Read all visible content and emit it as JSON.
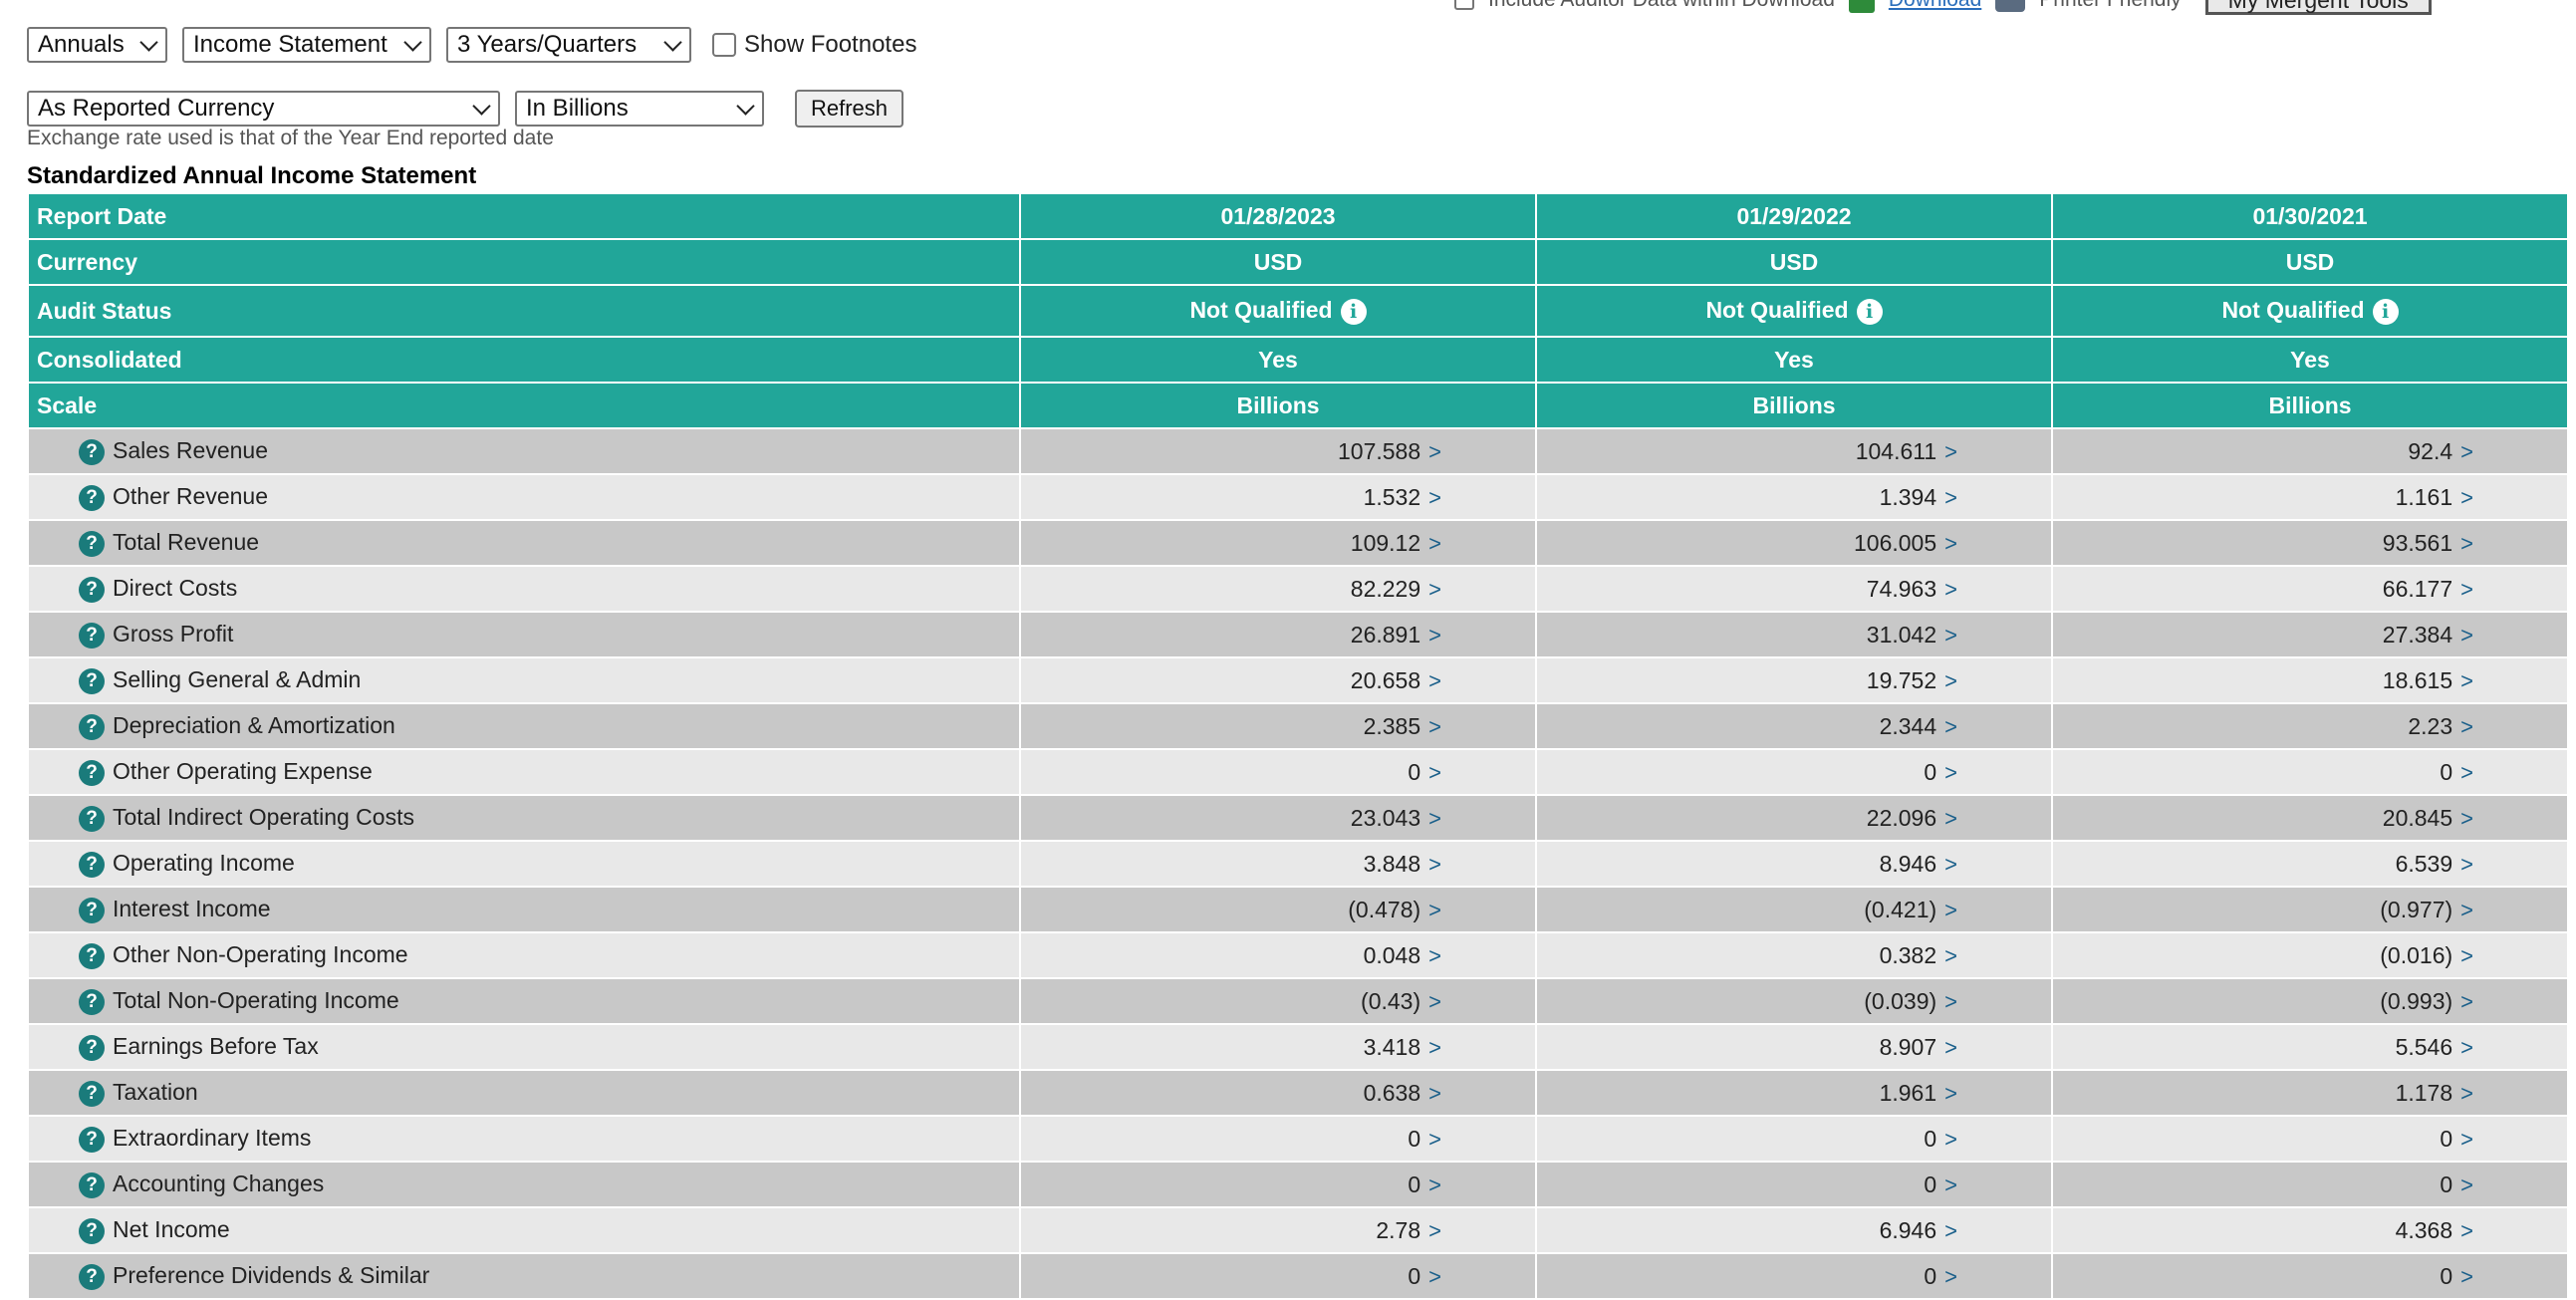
{
  "toolbar": {
    "include_text": "Include Auditor Data within Download",
    "download_label": "Download",
    "printer_label": "Printer Friendly",
    "mytools_label": "My Mergent Tools"
  },
  "controls": {
    "period_select": "Annuals",
    "statement_select": "Income Statement",
    "range_select": "3 Years/Quarters",
    "footnotes_label": "Show Footnotes",
    "currency_select": "As Reported Currency",
    "scale_select": "In Billions",
    "refresh_label": "Refresh",
    "exchange_note": "Exchange rate used is that of the Year End reported date"
  },
  "section_title": "Standardized Annual Income Statement",
  "header_rows": [
    {
      "label": "Report Date",
      "values": [
        "01/28/2023",
        "01/29/2022",
        "01/30/2021"
      ]
    },
    {
      "label": "Currency",
      "values": [
        "USD",
        "USD",
        "USD"
      ]
    },
    {
      "label": "Audit Status",
      "values": [
        "Not Qualified",
        "Not Qualified",
        "Not Qualified"
      ]
    },
    {
      "label": "Consolidated",
      "values": [
        "Yes",
        "Yes",
        "Yes"
      ]
    },
    {
      "label": "Scale",
      "values": [
        "Billions",
        "Billions",
        "Billions"
      ]
    }
  ],
  "rows": [
    {
      "label": "Sales Revenue",
      "values": [
        "107.588",
        "104.611",
        "92.4"
      ]
    },
    {
      "label": "Other Revenue",
      "values": [
        "1.532",
        "1.394",
        "1.161"
      ]
    },
    {
      "label": "Total Revenue",
      "values": [
        "109.12",
        "106.005",
        "93.561"
      ]
    },
    {
      "label": "Direct Costs",
      "values": [
        "82.229",
        "74.963",
        "66.177"
      ]
    },
    {
      "label": "Gross Profit",
      "values": [
        "26.891",
        "31.042",
        "27.384"
      ]
    },
    {
      "label": "Selling General & Admin",
      "values": [
        "20.658",
        "19.752",
        "18.615"
      ]
    },
    {
      "label": "Depreciation & Amortization",
      "values": [
        "2.385",
        "2.344",
        "2.23"
      ]
    },
    {
      "label": "Other Operating Expense",
      "values": [
        "0",
        "0",
        "0"
      ]
    },
    {
      "label": "Total Indirect Operating Costs",
      "values": [
        "23.043",
        "22.096",
        "20.845"
      ]
    },
    {
      "label": "Operating Income",
      "values": [
        "3.848",
        "8.946",
        "6.539"
      ]
    },
    {
      "label": "Interest Income",
      "values": [
        "(0.478)",
        "(0.421)",
        "(0.977)"
      ]
    },
    {
      "label": "Other Non-Operating Income",
      "values": [
        "0.048",
        "0.382",
        "(0.016)"
      ]
    },
    {
      "label": "Total Non-Operating Income",
      "values": [
        "(0.43)",
        "(0.039)",
        "(0.993)"
      ]
    },
    {
      "label": "Earnings Before Tax",
      "values": [
        "3.418",
        "8.907",
        "5.546"
      ]
    },
    {
      "label": "Taxation",
      "values": [
        "0.638",
        "1.961",
        "1.178"
      ]
    },
    {
      "label": "Extraordinary Items",
      "values": [
        "0",
        "0",
        "0"
      ]
    },
    {
      "label": "Accounting Changes",
      "values": [
        "0",
        "0",
        "0"
      ]
    },
    {
      "label": "Net Income",
      "values": [
        "2.78",
        "6.946",
        "4.368"
      ]
    },
    {
      "label": "Preference Dividends & Similar",
      "values": [
        "0",
        "0",
        "0"
      ]
    }
  ],
  "icons": {
    "help": "?",
    "info": "i",
    "detail_arrow": ">"
  },
  "colors": {
    "header_bg": "#21a699",
    "row_dark": "#c8c8c8",
    "row_light": "#e8e8e8",
    "help_icon": "#1a7b7b",
    "arrow": "#1a5f8a"
  }
}
